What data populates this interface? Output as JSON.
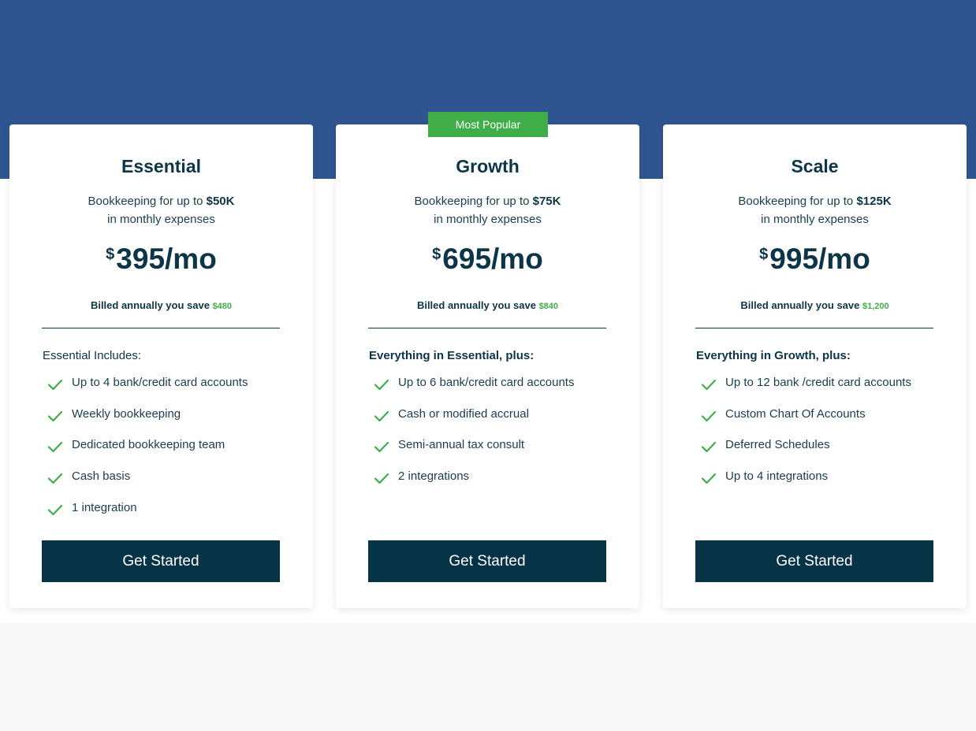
{
  "colors": {
    "hero": "#2f5591",
    "footer": "#f8f8f8",
    "accent_green": "#3fae49",
    "cta": "#063346",
    "text": "#0c3547"
  },
  "badge": {
    "label": "Most Popular"
  },
  "plans": [
    {
      "name": "Essential",
      "desc_prefix": "Bookkeeping for up to ",
      "desc_amount": "$50K",
      "desc_suffix": "in monthly expenses",
      "price_currency": "$",
      "price": "395/mo",
      "billed_label": "Billed annually you save ",
      "billed_save": "$480",
      "includes_title": "Essential Includes:",
      "includes_bold": false,
      "features": [
        "Up to 4 bank/credit card accounts",
        "Weekly bookkeeping",
        "Dedicated bookkeeping team",
        "Cash basis",
        "1 integration"
      ],
      "cta": "Get Started"
    },
    {
      "name": "Growth",
      "desc_prefix": "Bookkeeping for up to ",
      "desc_amount": "$75K",
      "desc_suffix": "in monthly expenses",
      "price_currency": "$",
      "price": "695/mo",
      "billed_label": "Billed annually you save ",
      "billed_save": "$840",
      "includes_title": "Everything in Essential, plus:",
      "includes_bold": true,
      "features": [
        "Up to 6 bank/credit card accounts",
        "Cash or modified accrual",
        "Semi-annual tax consult",
        "2 integrations"
      ],
      "cta": "Get Started"
    },
    {
      "name": "Scale",
      "desc_prefix": "Bookkeeping for up to ",
      "desc_amount": "$125K",
      "desc_suffix": "in monthly expenses",
      "price_currency": "$",
      "price": "995/mo",
      "billed_label": "Billed annually you save ",
      "billed_save": "$1,200",
      "includes_title": "Everything in Growth, plus:",
      "includes_bold": true,
      "features": [
        "Up to 12 bank /credit card accounts",
        "Custom Chart Of Accounts",
        "Deferred Schedules",
        "Up to 4 integrations"
      ],
      "cta": "Get Started"
    }
  ],
  "icons": {
    "feature": "check-icon"
  }
}
